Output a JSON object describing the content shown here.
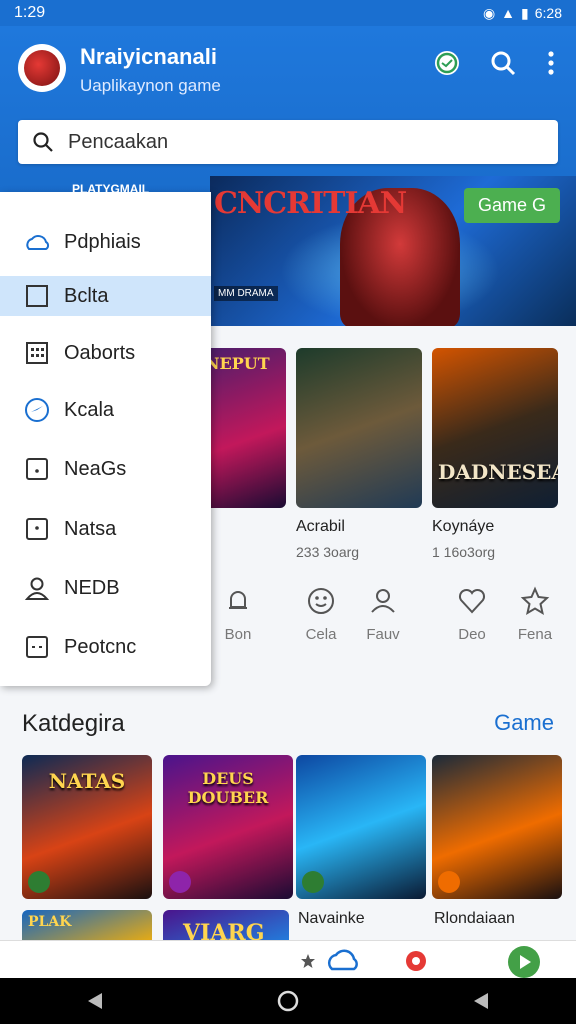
{
  "status_bar": {
    "time": "1:29",
    "right_text": "6:28"
  },
  "app": {
    "title": "Nraiyicnanali",
    "subtitle": "Uaplikaynon game"
  },
  "search": {
    "placeholder": "Pencaakan"
  },
  "banner": {
    "title": "CNCRITIAN",
    "button_label": "Game G",
    "tag": "MM DRAMA"
  },
  "drawer": {
    "header": "PLATYGMAIL",
    "items": [
      {
        "label": "Pdphiais",
        "icon": "cloud-icon"
      },
      {
        "label": "Bclta",
        "icon": "square-icon"
      },
      {
        "label": "Oaborts",
        "icon": "calendar-icon"
      },
      {
        "label": "Kcala",
        "icon": "compass-icon"
      },
      {
        "label": "NeaGs",
        "icon": "dot-square-icon"
      },
      {
        "label": "Natsa",
        "icon": "dot-square-icon"
      },
      {
        "label": "NEDB",
        "icon": "person-icon"
      },
      {
        "label": "Peotcnc",
        "icon": "face-square-icon"
      }
    ]
  },
  "popular": [
    {
      "top_text": "NONEPUT",
      "title": "",
      "name": "",
      "size": ""
    },
    {
      "top_text": "",
      "title": "",
      "name": "Acrabil",
      "size": "233 3oarg"
    },
    {
      "top_text": "",
      "title": "DADNESEA",
      "name": "Koynáye",
      "size": "1 16o3org"
    }
  ],
  "categories_row": [
    {
      "label": "Bon",
      "icon": "bell-icon"
    },
    {
      "label": "Cela",
      "icon": "smiley-icon"
    },
    {
      "label": "Fauv",
      "icon": "user-icon"
    },
    {
      "label": "Deo",
      "icon": "heart-icon"
    },
    {
      "label": "Fena",
      "icon": "star-icon"
    }
  ],
  "section": {
    "title": "Katdegira",
    "link": "Game"
  },
  "category_cards": [
    {
      "title": "NATAS"
    },
    {
      "title": "DEUS DOUBER"
    },
    {
      "title": ""
    },
    {
      "title": ""
    }
  ],
  "row2": {
    "card1_text": "PLAK",
    "card2_text": "VIARG",
    "name1": "Navainke",
    "name2": "Rlondaiaan"
  },
  "colors": {
    "primary": "#1a6fd0",
    "active_drawer": "#cfe5fb",
    "accent_green": "#4caf50"
  }
}
